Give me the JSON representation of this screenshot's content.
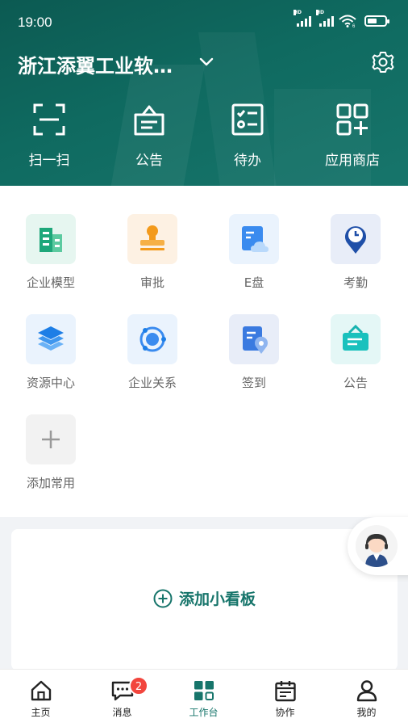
{
  "status_bar": {
    "time": "19:00",
    "battery_level": 0.55,
    "network_labels": [
      "HD",
      "HD"
    ],
    "wifi_label": "6"
  },
  "header": {
    "company_name": "浙江添翼工业软…",
    "quick_actions": [
      {
        "label": "扫一扫",
        "icon": "scan-icon"
      },
      {
        "label": "公告",
        "icon": "announcement-icon"
      },
      {
        "label": "待办",
        "icon": "todo-icon"
      },
      {
        "label": "应用商店",
        "icon": "app-store-icon"
      }
    ]
  },
  "apps": [
    {
      "label": "企业模型",
      "icon": "building-icon",
      "bg": "#e6f6f0"
    },
    {
      "label": "审批",
      "icon": "stamp-icon",
      "bg": "#fdf1e3"
    },
    {
      "label": "E盘",
      "icon": "cloud-drive-icon",
      "bg": "#eaf3fd"
    },
    {
      "label": "考勤",
      "icon": "location-clock-icon",
      "bg": "#e8edf8"
    },
    {
      "label": "资源中心",
      "icon": "layers-icon",
      "bg": "#eaf3fd"
    },
    {
      "label": "企业关系",
      "icon": "network-icon",
      "bg": "#eaf3fd"
    },
    {
      "label": "签到",
      "icon": "checkin-icon",
      "bg": "#e8edf8"
    },
    {
      "label": "公告",
      "icon": "announcement-icon",
      "bg": "#e4f7f6"
    },
    {
      "label": "添加常用",
      "icon": "plus-icon",
      "bg": "#f2f2f2"
    }
  ],
  "board": {
    "add_label": "添加小看板"
  },
  "tabs": [
    {
      "label": "主页",
      "icon": "home-icon"
    },
    {
      "label": "消息",
      "icon": "message-icon",
      "badge": "2"
    },
    {
      "label": "工作台",
      "icon": "workbench-icon",
      "active": true
    },
    {
      "label": "协作",
      "icon": "calendar-icon"
    },
    {
      "label": "我的",
      "icon": "user-icon"
    }
  ],
  "colors": {
    "brand": "#17756b",
    "header_bg": "#0f6a60",
    "badge": "#f2453d"
  }
}
